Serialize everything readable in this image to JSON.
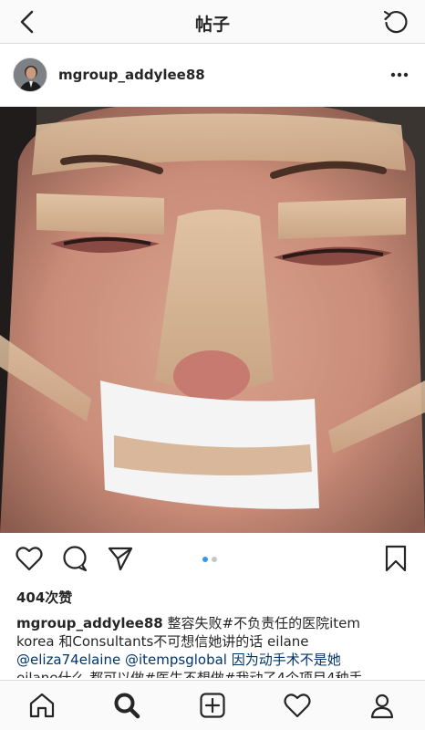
{
  "nav": {
    "title": "帖子",
    "back_icon": "chevron-left-icon",
    "refresh_icon": "refresh-icon"
  },
  "post": {
    "username": "mgroup_addylee88",
    "more_icon": "more-horizontal-icon",
    "photo_alt": "",
    "likes": "404次赞",
    "carousel": {
      "count": 2,
      "active": 0
    },
    "caption": {
      "username": "mgroup_addylee88",
      "lines": [
        "整容失败#不负责任的医院item",
        "korea 和Consultants不可想信她讲的话 eilane",
        "@eliza74elaine @itempsglobal  因为动手术不是她",
        "eilane什么 都可以做#医生不想做#我动了4个项目4种手"
      ]
    }
  },
  "actions": [
    "heart-icon",
    "comment-icon",
    "share-icon",
    "bookmark-icon"
  ],
  "tabbar": [
    "home-icon",
    "search-icon",
    "add-post-icon",
    "activity-heart-icon",
    "profile-icon"
  ],
  "colors": {
    "link": "#003569",
    "dot_active": "#3897f0",
    "border": "#dbdbdb"
  }
}
